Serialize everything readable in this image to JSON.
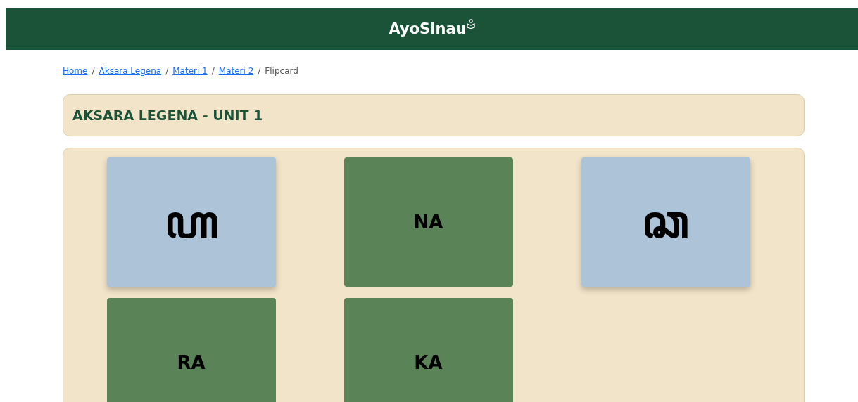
{
  "header": {
    "logo": "AyoSinau"
  },
  "breadcrumb_separator": "/",
  "breadcrumb": [
    {
      "label": "Home",
      "link": true
    },
    {
      "label": "Aksara Legena",
      "link": true
    },
    {
      "label": "Materi 1",
      "link": true
    },
    {
      "label": "Materi 2",
      "link": true
    },
    {
      "label": "Flipcard",
      "link": false
    }
  ],
  "unit_title": "AKSARA LEGENA - UNIT 1",
  "cards": [
    {
      "text": "ꦲ",
      "flipped": false
    },
    {
      "text": "NA",
      "flipped": true
    },
    {
      "text": "ꦕ",
      "flipped": false
    },
    {
      "text": "RA",
      "flipped": true
    },
    {
      "text": "KA",
      "flipped": true
    }
  ]
}
